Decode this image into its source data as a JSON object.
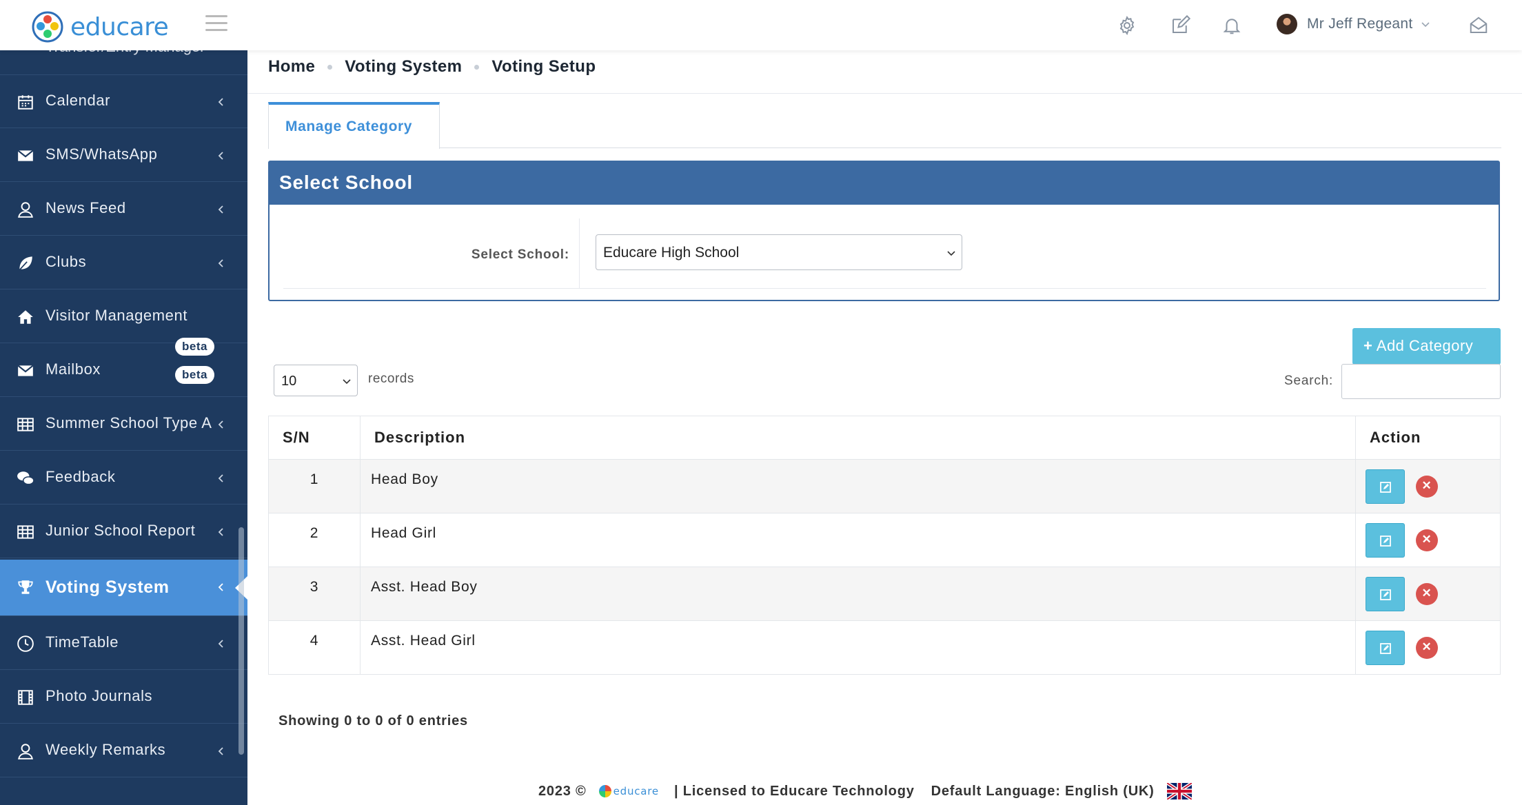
{
  "app": {
    "logo_text": "educare"
  },
  "user": {
    "name": "Mr Jeff Regeant"
  },
  "sidebar": {
    "partial_top_label": "Transfer/Entry Manager",
    "items": [
      {
        "label": "Calendar",
        "icon": "calendar-icon"
      },
      {
        "label": "SMS/WhatsApp",
        "icon": "envelope-icon"
      },
      {
        "label": "News Feed",
        "icon": "user-outline-icon"
      },
      {
        "label": "Clubs",
        "icon": "leaf-icon"
      },
      {
        "label": "Visitor Management",
        "icon": "home-icon"
      },
      {
        "label": "Mailbox",
        "icon": "envelope-icon",
        "badge": "beta"
      },
      {
        "label": "Summer School Type A",
        "icon": "table-icon"
      },
      {
        "label": "Feedback",
        "icon": "comments-icon"
      },
      {
        "label": "Junior School Report",
        "icon": "table-icon"
      },
      {
        "label": "Voting System",
        "icon": "trophy-icon",
        "active": true
      },
      {
        "label": "TimeTable",
        "icon": "clock-icon"
      },
      {
        "label": "Photo Journals",
        "icon": "film-icon"
      },
      {
        "label": "Weekly Remarks",
        "icon": "user-outline-icon"
      }
    ],
    "extra_badge": "beta"
  },
  "breadcrumb": [
    "Home",
    "Voting System",
    "Voting Setup"
  ],
  "tabs": [
    {
      "label": "Manage Category"
    }
  ],
  "panel": {
    "title": "Select School",
    "field_label": "Select School:",
    "selected_school": "Educare High School"
  },
  "toolbar": {
    "add_label": "Add Category",
    "records_value": "10",
    "records_label": "records",
    "search_label": "Search:",
    "search_value": ""
  },
  "table": {
    "headers": [
      "S/N",
      "Description",
      "Action"
    ],
    "rows": [
      {
        "sn": "1",
        "description": "Head Boy"
      },
      {
        "sn": "2",
        "description": "Head Girl"
      },
      {
        "sn": "3",
        "description": "Asst. Head Boy"
      },
      {
        "sn": "4",
        "description": "Asst. Head Girl"
      }
    ]
  },
  "showing_text": "Showing 0 to 0 of 0 entries",
  "footer": {
    "year": "2023 ©",
    "mini_logo_text": "educare",
    "licensed": "| Licensed to Educare Technology",
    "language": "Default Language: English (UK)"
  },
  "colors": {
    "sidebar_bg": "#1e3a5f",
    "active_item": "#4a90d9",
    "panel_head": "#3c6aa2",
    "info_button": "#5bc0de",
    "danger": "#d9534f"
  }
}
